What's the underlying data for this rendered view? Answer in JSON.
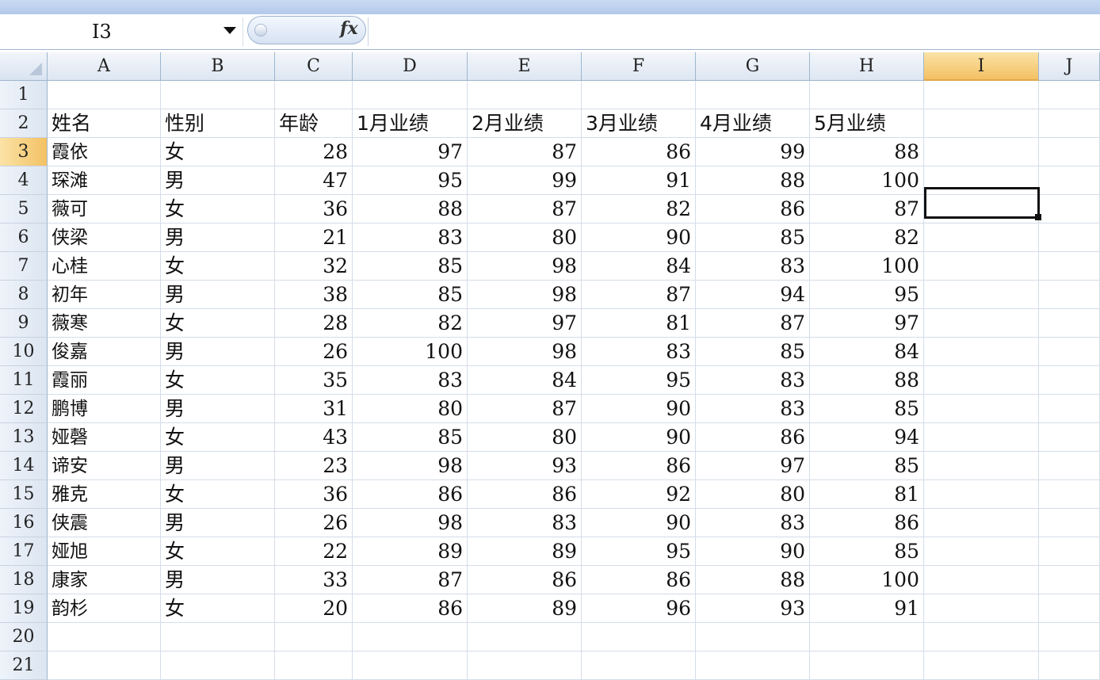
{
  "formula_bar": {
    "name_box": "I3",
    "fx_label": "fx",
    "formula": ""
  },
  "columns": [
    "A",
    "B",
    "C",
    "D",
    "E",
    "F",
    "G",
    "H",
    "I",
    "J"
  ],
  "active_column": "I",
  "active_row": 3,
  "rows": [
    1,
    2,
    3,
    4,
    5,
    6,
    7,
    8,
    9,
    10,
    11,
    12,
    13,
    14,
    15,
    16,
    17,
    18,
    19,
    20,
    21
  ],
  "table": {
    "headers": [
      "姓名",
      "性别",
      "年龄",
      "1月业绩",
      "2月业绩",
      "3月业绩",
      "4月业绩",
      "5月业绩"
    ],
    "records": [
      [
        "霞依",
        "女",
        28,
        97,
        87,
        86,
        99,
        88
      ],
      [
        "琛滩",
        "男",
        47,
        95,
        99,
        91,
        88,
        100
      ],
      [
        "薇可",
        "女",
        36,
        88,
        87,
        82,
        86,
        87
      ],
      [
        "侠梁",
        "男",
        21,
        83,
        80,
        90,
        85,
        82
      ],
      [
        "心桂",
        "女",
        32,
        85,
        98,
        84,
        83,
        100
      ],
      [
        "初年",
        "男",
        38,
        85,
        98,
        87,
        94,
        95
      ],
      [
        "薇寒",
        "女",
        28,
        82,
        97,
        81,
        87,
        97
      ],
      [
        "俊嘉",
        "男",
        26,
        100,
        98,
        83,
        85,
        84
      ],
      [
        "霞丽",
        "女",
        35,
        83,
        84,
        95,
        83,
        88
      ],
      [
        "鹏博",
        "男",
        31,
        80,
        87,
        90,
        83,
        85
      ],
      [
        "娅磬",
        "女",
        43,
        85,
        80,
        90,
        86,
        94
      ],
      [
        "谛安",
        "男",
        23,
        98,
        93,
        86,
        97,
        85
      ],
      [
        "雅克",
        "女",
        36,
        86,
        86,
        92,
        80,
        81
      ],
      [
        "侠震",
        "男",
        26,
        98,
        83,
        90,
        83,
        86
      ],
      [
        "娅旭",
        "女",
        22,
        89,
        89,
        95,
        90,
        85
      ],
      [
        "康家",
        "男",
        33,
        87,
        86,
        86,
        88,
        100
      ],
      [
        "韵杉",
        "女",
        20,
        86,
        89,
        96,
        93,
        91
      ]
    ]
  }
}
